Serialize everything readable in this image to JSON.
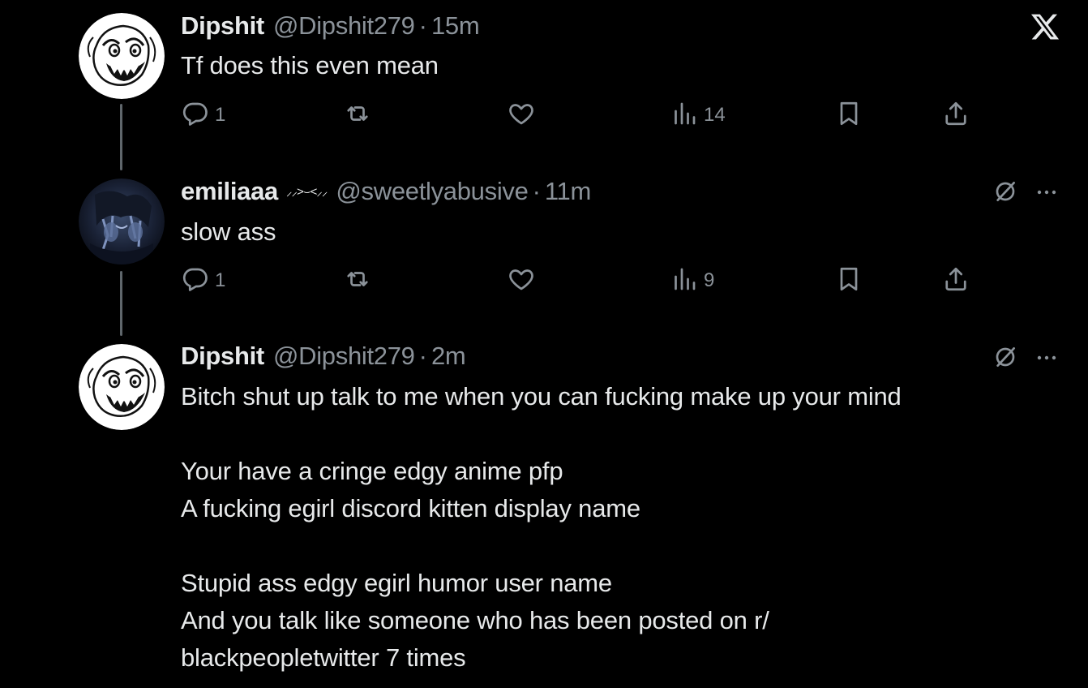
{
  "app": {
    "logo_icon": "x-logo-icon"
  },
  "thread": [
    {
      "display_name": "Dipshit",
      "handle": "@Dipshit279",
      "separator": "·",
      "time": "15m",
      "text_lines": [
        "Tf does this even mean"
      ],
      "actions": {
        "replies": "1",
        "retweets": "",
        "likes": "",
        "views": "14"
      },
      "show_more": false
    },
    {
      "display_name": "emiliaaa",
      "name_decoration": "⸝⸝>⌣<⸝⸝",
      "handle": "@sweetlyabusive",
      "separator": "·",
      "time": "11m",
      "text_lines": [
        "slow ass"
      ],
      "actions": {
        "replies": "1",
        "retweets": "",
        "likes": "",
        "views": "9"
      },
      "show_more": true
    },
    {
      "display_name": "Dipshit",
      "handle": "@Dipshit279",
      "separator": "·",
      "time": "2m",
      "text_lines": [
        "Bitch shut up talk to me when you can fucking make up your mind",
        "",
        "Your have a cringe edgy anime pfp",
        "A fucking egirl discord kitten display name",
        "",
        "Stupid ass edgy egirl humor user name",
        "And you talk like someone who has been posted on r/",
        "blackpeopletwitter 7 times"
      ],
      "show_more": true
    }
  ],
  "colors": {
    "background": "#000000",
    "text": "#e7e9ea",
    "muted": "#8b9299",
    "thread_line": "#5f666b"
  }
}
